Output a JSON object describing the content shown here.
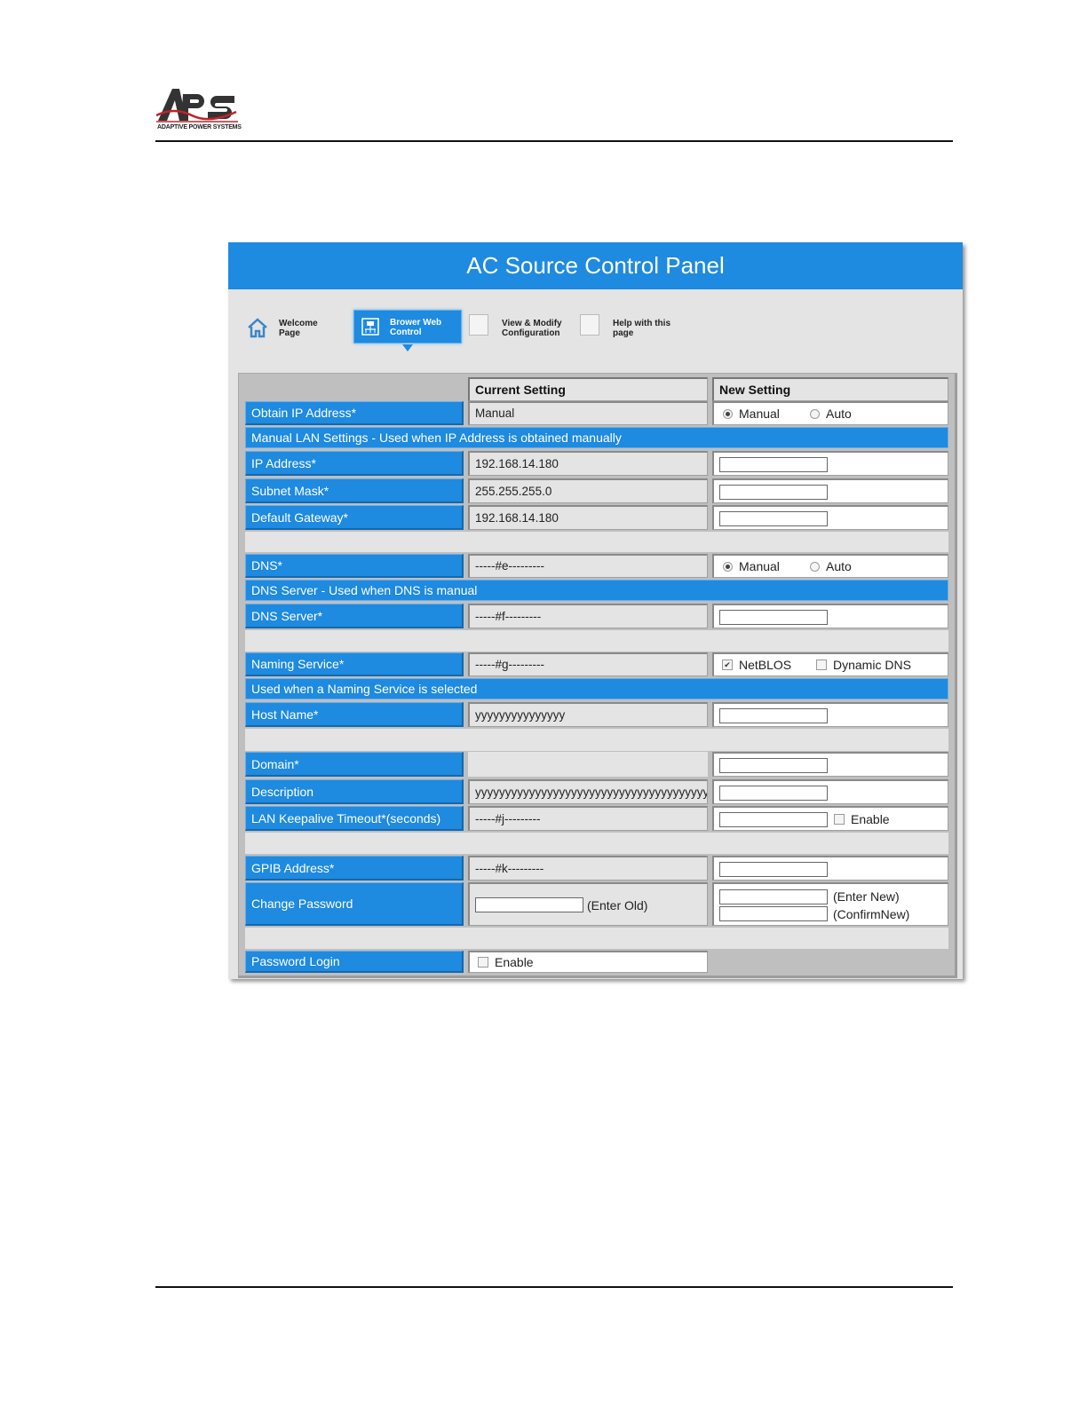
{
  "logo": {
    "text": "APS",
    "subtitle": "ADAPTIVE POWER SYSTEMS"
  },
  "panel": {
    "title": "AC Source Control Panel"
  },
  "nav": {
    "items": [
      {
        "label": "Welcome\nPage",
        "icon": "home-icon"
      },
      {
        "label": "Brower Web\nControl",
        "icon": "web-control-icon",
        "active": true
      },
      {
        "label": "View & Modify\nConfiguration",
        "icon": "broken-image-icon"
      },
      {
        "label": "Help with this\npage",
        "icon": "broken-image-icon"
      }
    ]
  },
  "columns": {
    "current": "Current Setting",
    "new": "New Setting"
  },
  "rows": {
    "obtain_ip": {
      "label": "Obtain IP Address*",
      "current": "Manual",
      "options": [
        "Manual",
        "Auto"
      ],
      "selected": "Manual"
    },
    "manual_band": "Manual LAN Settings - Used when IP Address is obtained manually",
    "ip": {
      "label": "IP Address*",
      "current": "192.168.14.180"
    },
    "subnet": {
      "label": "Subnet Mask*",
      "current": "255.255.255.0"
    },
    "gateway": {
      "label": "Default Gateway*",
      "current": "192.168.14.180"
    },
    "dns": {
      "label": "DNS*",
      "current": "-----#e---------",
      "options": [
        "Manual",
        "Auto"
      ],
      "selected": "Manual"
    },
    "dns_band": "DNS Server - Used when DNS is manual",
    "dns_server": {
      "label": "DNS Server*",
      "current": "-----#f---------"
    },
    "naming": {
      "label": "Naming Service*",
      "current": "-----#g---------",
      "options": [
        "NetBLOS",
        "Dynamic DNS"
      ],
      "checked": [
        "NetBLOS"
      ]
    },
    "naming_band": "Used when a Naming Service is selected",
    "host": {
      "label": "Host Name*",
      "current": "yyyyyyyyyyyyyyy"
    },
    "domain": {
      "label": "Domain*"
    },
    "description": {
      "label": "Description",
      "current": "yyyyyyyyyyyyyyyyyyyyyyyyyyyyyyyyyyyyyyyyyy"
    },
    "keepalive": {
      "label": "LAN Keepalive Timeout*(seconds)",
      "current": "-----#j---------",
      "enable": "Enable"
    },
    "gpib": {
      "label": "GPIB Address*",
      "current": "-----#k---------"
    },
    "password": {
      "label": "Change Password",
      "enter_old": "(Enter Old)",
      "enter_new": "(Enter New)",
      "confirm_new": "(ConfirmNew)"
    },
    "password_login": {
      "label": "Password Login",
      "enable": "Enable"
    }
  },
  "colors": {
    "accent": "#1e8ae0",
    "panel_bg": "#e4e4e4",
    "form_bg": "#bfbfbf"
  }
}
